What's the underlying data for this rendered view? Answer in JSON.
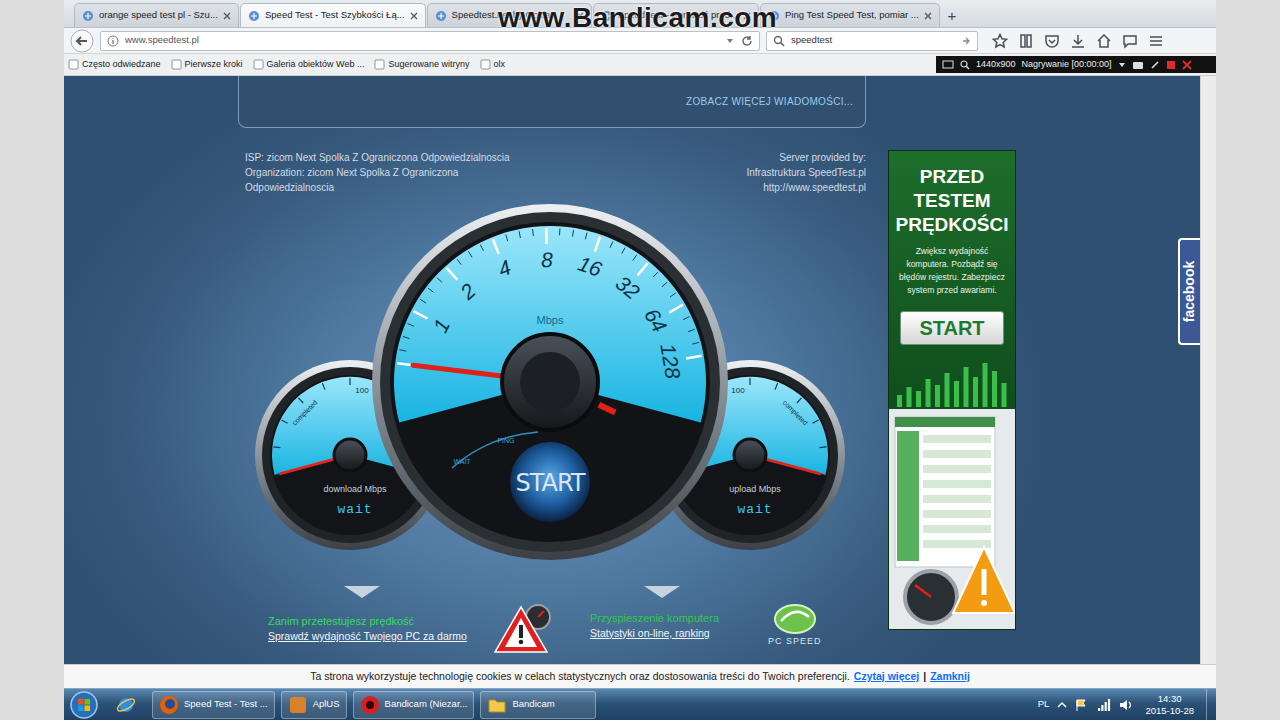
{
  "browser": {
    "tabs": [
      {
        "label": "orange speed test pl - Szu...",
        "selected": false
      },
      {
        "label": "Speed Test - Test Szybkości Łą...",
        "selected": true
      },
      {
        "label": "Speedtest.net by Ookla",
        "selected": false
      },
      {
        "label": "Speed test - Sprawdź pręd...",
        "selected": false
      },
      {
        "label": "Ping Test Speed Test, pomiar ...",
        "selected": false
      }
    ],
    "new_tab": "+",
    "url": "www.speedtest.pl",
    "search": "speedtest",
    "bookmarks": [
      "Często odwiedzane",
      "Pierwsze kroki",
      "Galeria obiektów Web ...",
      "Sugerowane witryny",
      "olx"
    ]
  },
  "watermark": "www.Bandicam.com",
  "recorder": {
    "resolution": "1440x900",
    "status": "Nagrywanie [00:00:00]"
  },
  "page": {
    "news_link": "ZOBACZ WIĘCEJ WIADOMOŚCI...",
    "isp": "ISP: zicom Next Spolka Z Ograniczona Odpowiedzialnoscia",
    "organization": "Organization: zicom Next Spolka Z Ograniczona Odpowiedzialnoscia",
    "server_label": "Server provided by:",
    "server_name": "Infrastruktura SpeedTest.pl",
    "server_url": "http://www.speedtest.pl",
    "gauge": {
      "unit": "Mbps",
      "ticks": [
        "1",
        "2",
        "4",
        "8",
        "16",
        "32",
        "64",
        "128"
      ],
      "level": 0,
      "ping_label": "PING",
      "wait_label": "WAIT",
      "start": "START"
    },
    "download": {
      "label": "download Mbps",
      "value": "wait",
      "level": 0,
      "scale_max": "100",
      "caption": "completed"
    },
    "upload": {
      "label": "upload Mbps",
      "value": "wait",
      "level": 0,
      "scale_max": "100",
      "caption": "completed"
    },
    "promos": [
      {
        "title": "Zanim przetestujesz prędkość",
        "link": "Sprawdź wydajność Twojego PC za darmo"
      },
      {
        "title": "Przyspieszenie komputera",
        "link": "Statystyki on-line, ranking"
      }
    ],
    "pc_speed": "PC SPEED",
    "ad": {
      "title": "PRZED TESTEM PRĘDKOŚCI",
      "text": "Zwiększ wydajność komputera. Pozbądź się błędów rejestru. Zabezpiecz system przed awariami.",
      "button": "START"
    },
    "facebook": "facebook",
    "cookie": {
      "text": "Ta strona wykorzystuje technologię cookies w celach statystycznych oraz dostosowania treści do Twoich preferencji.",
      "more": "Czytaj więcej",
      "separator": "|",
      "close": "Zamknij"
    }
  },
  "taskbar": {
    "items": [
      {
        "kind": "ie"
      },
      {
        "kind": "firefox",
        "label": "Speed Test - Test ..."
      },
      {
        "kind": "app",
        "label": "AplUS"
      },
      {
        "kind": "bandicam",
        "label": "Bandicam (Niezar..."
      },
      {
        "kind": "folder",
        "label": "Bandicam"
      }
    ],
    "language": "PL",
    "time": "14:30",
    "date": "2015-10-28"
  }
}
